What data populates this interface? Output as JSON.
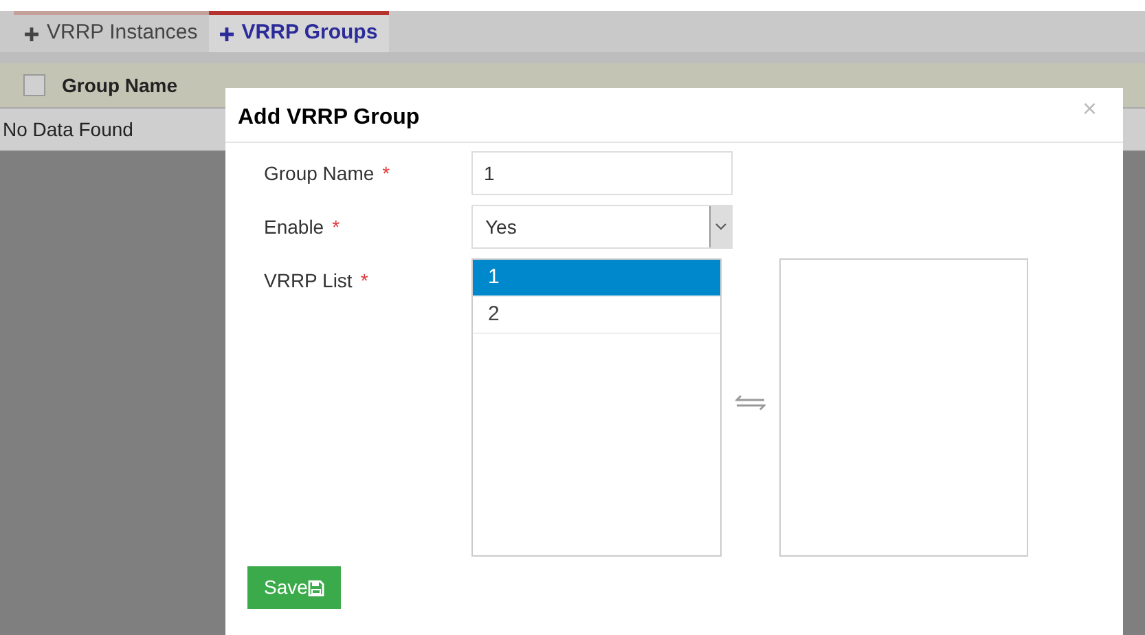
{
  "tabs": [
    {
      "label": "VRRP Instances",
      "selected": false
    },
    {
      "label": "VRRP Groups",
      "selected": true
    }
  ],
  "table": {
    "select_all": {
      "checked": false
    },
    "columns": [
      "Group Name"
    ],
    "empty_message": "No Data Found"
  },
  "dialog": {
    "title": "Add VRRP Group",
    "close": "×",
    "fields": [
      {
        "kind": "text",
        "label": "Group Name",
        "required_mark": "*",
        "value": "1"
      },
      {
        "kind": "select",
        "label": "Enable",
        "required_mark": "*",
        "value": "Yes"
      },
      {
        "kind": "transfer",
        "label": "VRRP List",
        "required_mark": "*",
        "options": [
          {
            "label": "1",
            "selected": true
          },
          {
            "label": "2",
            "selected": false
          }
        ]
      }
    ],
    "save_button": "Save"
  }
}
